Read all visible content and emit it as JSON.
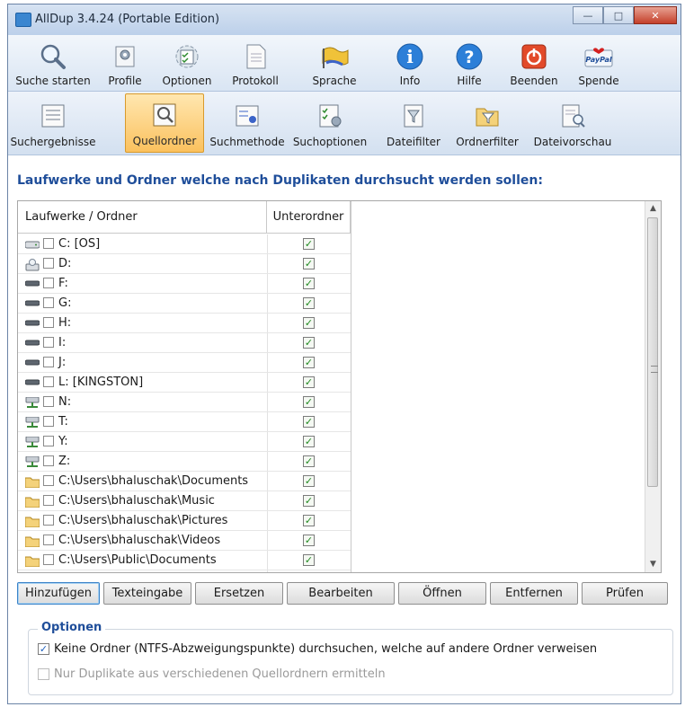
{
  "window": {
    "title": "AllDup 3.4.24 (Portable Edition)"
  },
  "toolbar_main": [
    {
      "label": "Suche starten",
      "icon": "search-icon"
    },
    {
      "label": "Profile",
      "icon": "profile-icon"
    },
    {
      "label": "Optionen",
      "icon": "options-icon"
    },
    {
      "label": "Protokoll",
      "icon": "log-icon"
    },
    {
      "label": "Sprache",
      "icon": "language-icon"
    },
    {
      "label": "Info",
      "icon": "info-icon"
    },
    {
      "label": "Hilfe",
      "icon": "help-icon"
    },
    {
      "label": "Beenden",
      "icon": "power-icon"
    },
    {
      "label": "Spende",
      "icon": "paypal-icon"
    }
  ],
  "toolbar_tabs": [
    {
      "label": "Suchergebnisse",
      "icon": "results-icon",
      "active": false
    },
    {
      "label": "Quellordner",
      "icon": "source-folder-icon",
      "active": true
    },
    {
      "label": "Suchmethode",
      "icon": "search-method-icon",
      "active": false
    },
    {
      "label": "Suchoptionen",
      "icon": "search-options-icon",
      "active": false
    },
    {
      "label": "Dateifilter",
      "icon": "file-filter-icon",
      "active": false
    },
    {
      "label": "Ordnerfilter",
      "icon": "folder-filter-icon",
      "active": false
    },
    {
      "label": "Dateivorschau",
      "icon": "file-preview-icon",
      "active": false
    }
  ],
  "main": {
    "heading": "Laufwerke und Ordner welche nach Duplikaten durchsucht werden sollen:",
    "columns": [
      "Laufwerke / Ordner",
      "Unterordner"
    ],
    "rows": [
      {
        "name": "C: [OS]",
        "icon": "hard-drive-icon",
        "checked": false,
        "subfolders": true
      },
      {
        "name": "D:",
        "icon": "cd-drive-icon",
        "checked": false,
        "subfolders": true
      },
      {
        "name": "F:",
        "icon": "removable-drive-icon",
        "checked": false,
        "subfolders": true
      },
      {
        "name": "G:",
        "icon": "removable-drive-icon",
        "checked": false,
        "subfolders": true
      },
      {
        "name": "H:",
        "icon": "removable-drive-icon",
        "checked": false,
        "subfolders": true
      },
      {
        "name": "I:",
        "icon": "removable-drive-icon",
        "checked": false,
        "subfolders": true
      },
      {
        "name": "J:",
        "icon": "removable-drive-icon",
        "checked": false,
        "subfolders": true
      },
      {
        "name": "L: [KINGSTON]",
        "icon": "removable-drive-icon",
        "checked": false,
        "subfolders": true
      },
      {
        "name": "N:",
        "icon": "network-drive-icon",
        "checked": false,
        "subfolders": true
      },
      {
        "name": "T:",
        "icon": "network-drive-icon",
        "checked": false,
        "subfolders": true
      },
      {
        "name": "Y:",
        "icon": "network-drive-icon",
        "checked": false,
        "subfolders": true
      },
      {
        "name": "Z:",
        "icon": "network-drive-icon",
        "checked": false,
        "subfolders": true
      },
      {
        "name": "C:\\Users\\bhaluschak\\Documents",
        "icon": "folder-icon",
        "checked": false,
        "subfolders": true
      },
      {
        "name": "C:\\Users\\bhaluschak\\Music",
        "icon": "folder-icon",
        "checked": false,
        "subfolders": true
      },
      {
        "name": "C:\\Users\\bhaluschak\\Pictures",
        "icon": "folder-icon",
        "checked": false,
        "subfolders": true
      },
      {
        "name": "C:\\Users\\bhaluschak\\Videos",
        "icon": "folder-icon",
        "checked": false,
        "subfolders": true
      },
      {
        "name": "C:\\Users\\Public\\Documents",
        "icon": "folder-icon",
        "checked": false,
        "subfolders": true
      }
    ]
  },
  "buttons": [
    "Hinzufügen",
    "Texteingabe",
    "Ersetzen",
    "Bearbeiten",
    "Öffnen",
    "Entfernen",
    "Prüfen"
  ],
  "options": {
    "legend": "Optionen",
    "items": [
      {
        "label": "Keine Ordner (NTFS-Abzweigungspunkte) durchsuchen, welche auf andere Ordner verweisen",
        "checked": true,
        "enabled": true
      },
      {
        "label": "Nur Duplikate aus verschiedenen Quellordnern ermitteln",
        "checked": false,
        "enabled": false
      }
    ]
  },
  "colors": {
    "heading": "#1f4e9a",
    "active_tab": "#fbc15e",
    "check_green": "#1f8a1f"
  }
}
